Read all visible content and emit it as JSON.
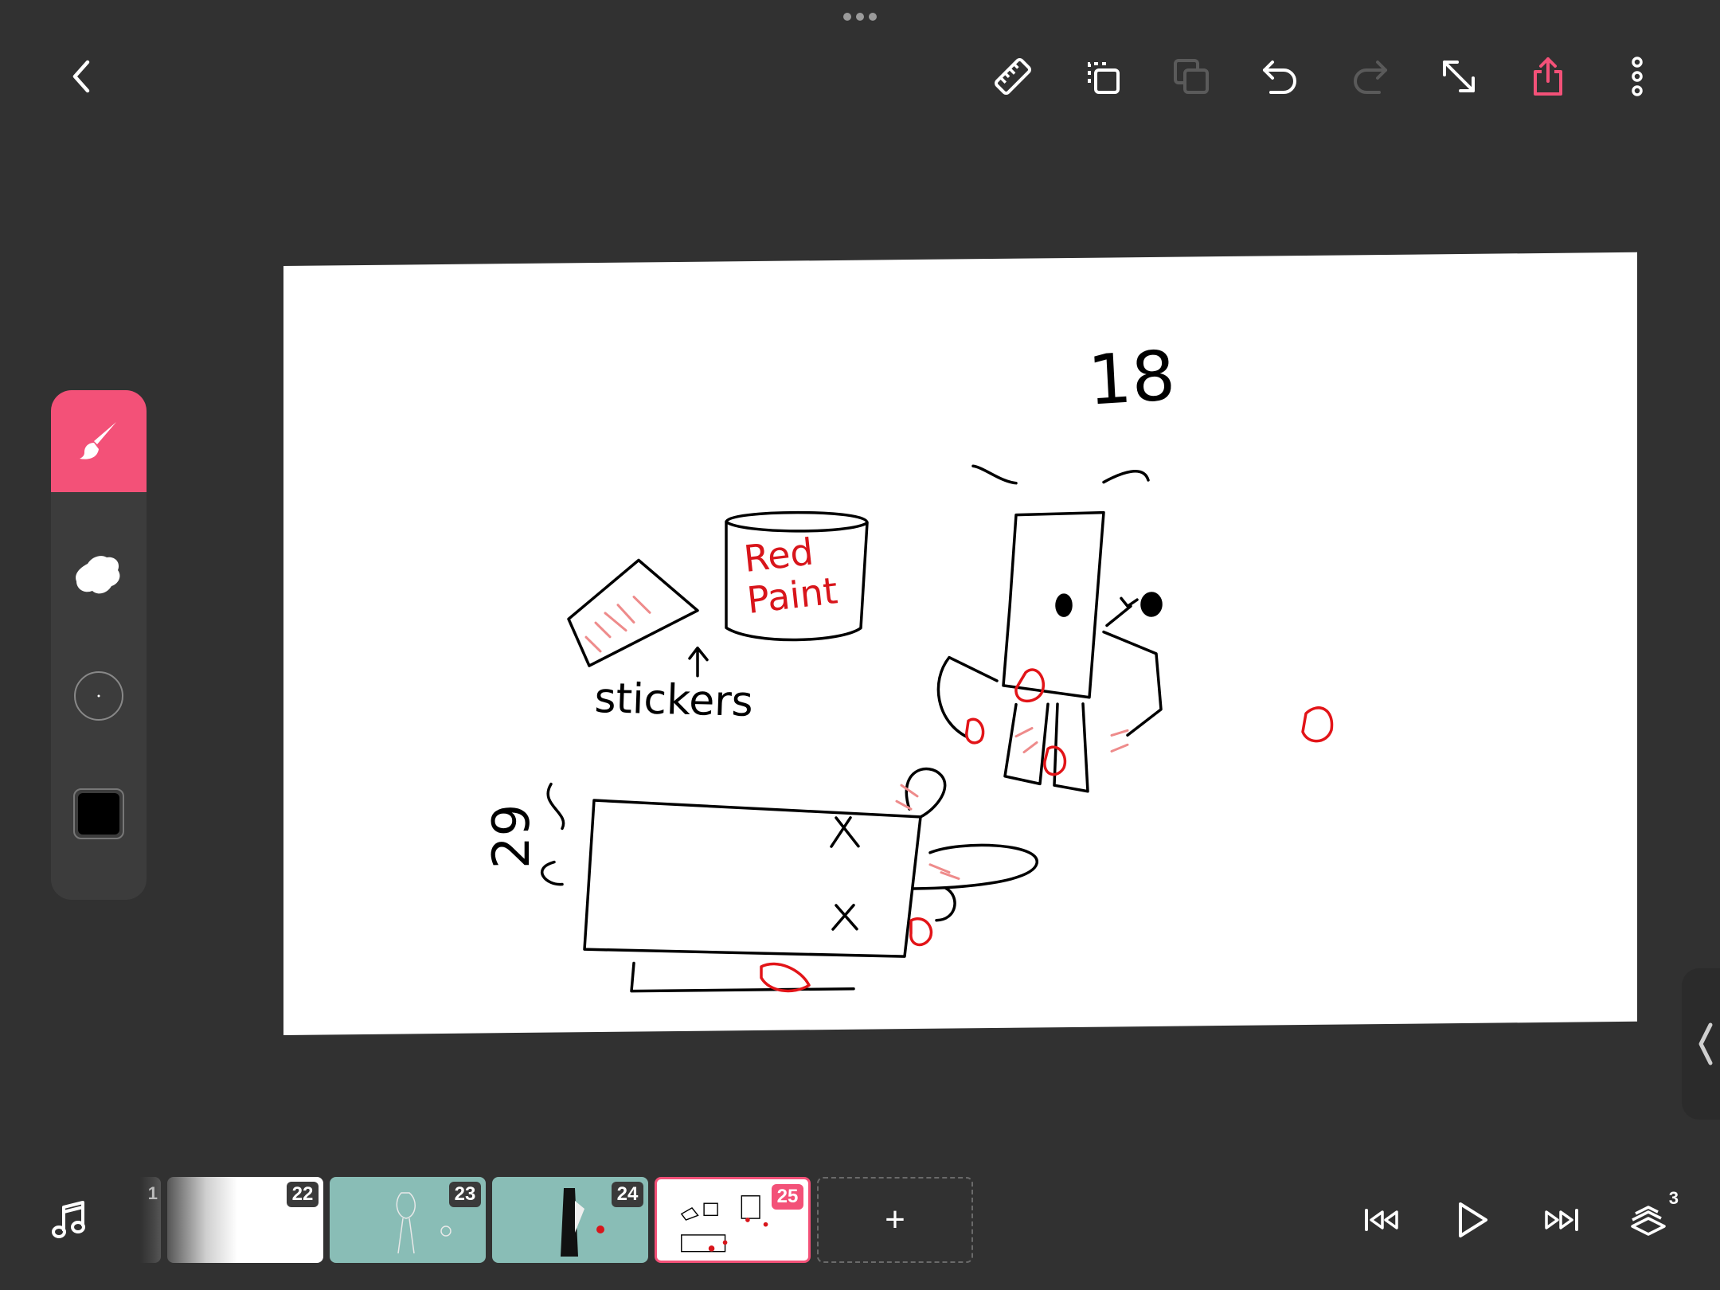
{
  "app": {
    "accent": "#f35178",
    "background": "#313131"
  },
  "toolbar": {
    "icons": [
      "back-icon",
      "ruler-icon",
      "copy-frame-icon",
      "paste-frame-icon",
      "undo-icon",
      "redo-icon",
      "resize-icon",
      "export-icon",
      "more-icon"
    ]
  },
  "tools": {
    "items": [
      "brush-icon",
      "eraser-icon",
      "brush-size-icon",
      "color-swatch"
    ],
    "current_color": "#000000"
  },
  "drawing": {
    "label_stickers": "stickers",
    "label_paint_line1": "Red",
    "label_paint_line2": "Paint",
    "number_top": "18",
    "number_left": "29"
  },
  "timeline": {
    "partial_frame": "1",
    "frames": [
      {
        "number": "22"
      },
      {
        "number": "23"
      },
      {
        "number": "24"
      },
      {
        "number": "25",
        "selected": true
      }
    ],
    "add_label": "+",
    "layers_count": "3"
  }
}
